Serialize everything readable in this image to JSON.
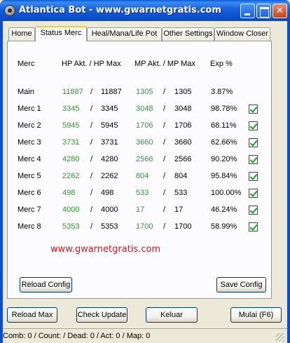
{
  "window": {
    "title": "Atlantica Bot - www.gwarnetgratis.com"
  },
  "tabs": [
    {
      "label": "Home",
      "active": false
    },
    {
      "label": "Status Merc",
      "active": true
    },
    {
      "label": "Heal/Mana/Life Pot",
      "active": false
    },
    {
      "label": "Other Settings",
      "active": false
    },
    {
      "label": "Window Closer",
      "active": false
    }
  ],
  "table": {
    "headers": {
      "merc": "Merc",
      "hp": "HP Akt.  / HP Max",
      "mp": "MP Akt. / MP Max",
      "exp": "Exp %"
    },
    "rows": [
      {
        "name": "Main",
        "hp_akt": "11887",
        "hp_max": "11887",
        "mp_akt": "1305",
        "mp_max": "1305",
        "exp": "3.87%",
        "checked": false
      },
      {
        "name": "Merc 1",
        "hp_akt": "3345",
        "hp_max": "3345",
        "mp_akt": "3048",
        "mp_max": "3048",
        "exp": "98.78%",
        "checked": true
      },
      {
        "name": "Merc 2",
        "hp_akt": "5945",
        "hp_max": "5945",
        "mp_akt": "1706",
        "mp_max": "1706",
        "exp": "68.11%",
        "checked": true
      },
      {
        "name": "Merc 3",
        "hp_akt": "3731",
        "hp_max": "3731",
        "mp_akt": "3660",
        "mp_max": "3660",
        "exp": "62.66%",
        "checked": true
      },
      {
        "name": "Merc 4",
        "hp_akt": "4280",
        "hp_max": "4280",
        "mp_akt": "2566",
        "mp_max": "2566",
        "exp": "90.20%",
        "checked": true
      },
      {
        "name": "Merc 5",
        "hp_akt": "2262",
        "hp_max": "2262",
        "mp_akt": "804",
        "mp_max": "804",
        "exp": "95.84%",
        "checked": true
      },
      {
        "name": "Merc 6",
        "hp_akt": "498",
        "hp_max": "498",
        "mp_akt": "533",
        "mp_max": "533",
        "exp": "100.00%",
        "checked": true
      },
      {
        "name": "Merc 7",
        "hp_akt": "4000",
        "hp_max": "4000",
        "mp_akt": "17",
        "mp_max": "17",
        "exp": "46.24%",
        "checked": true
      },
      {
        "name": "Merc 8",
        "hp_akt": "5353",
        "hp_max": "5353",
        "mp_akt": "1700",
        "mp_max": "1700",
        "exp": "58.99%",
        "checked": true
      }
    ],
    "separator": "/"
  },
  "website": "www.gwarnetgratis.com",
  "panel_buttons": {
    "reload_config": "Reload Config",
    "save_config": "Save Config"
  },
  "bottom_buttons": {
    "reload_max": "Reload Max",
    "check_update": "Check Update",
    "keluar": "Keluar",
    "mulai": "Mulai (F6)"
  },
  "status_bar": "Comb: 0 / Count:  / Dead: 0 / Act: 0 / Map: 0",
  "colors": {
    "value_green": "#2a9b2a",
    "website_red": "#e0141a",
    "titlebar_blue": "#0d54d2"
  }
}
